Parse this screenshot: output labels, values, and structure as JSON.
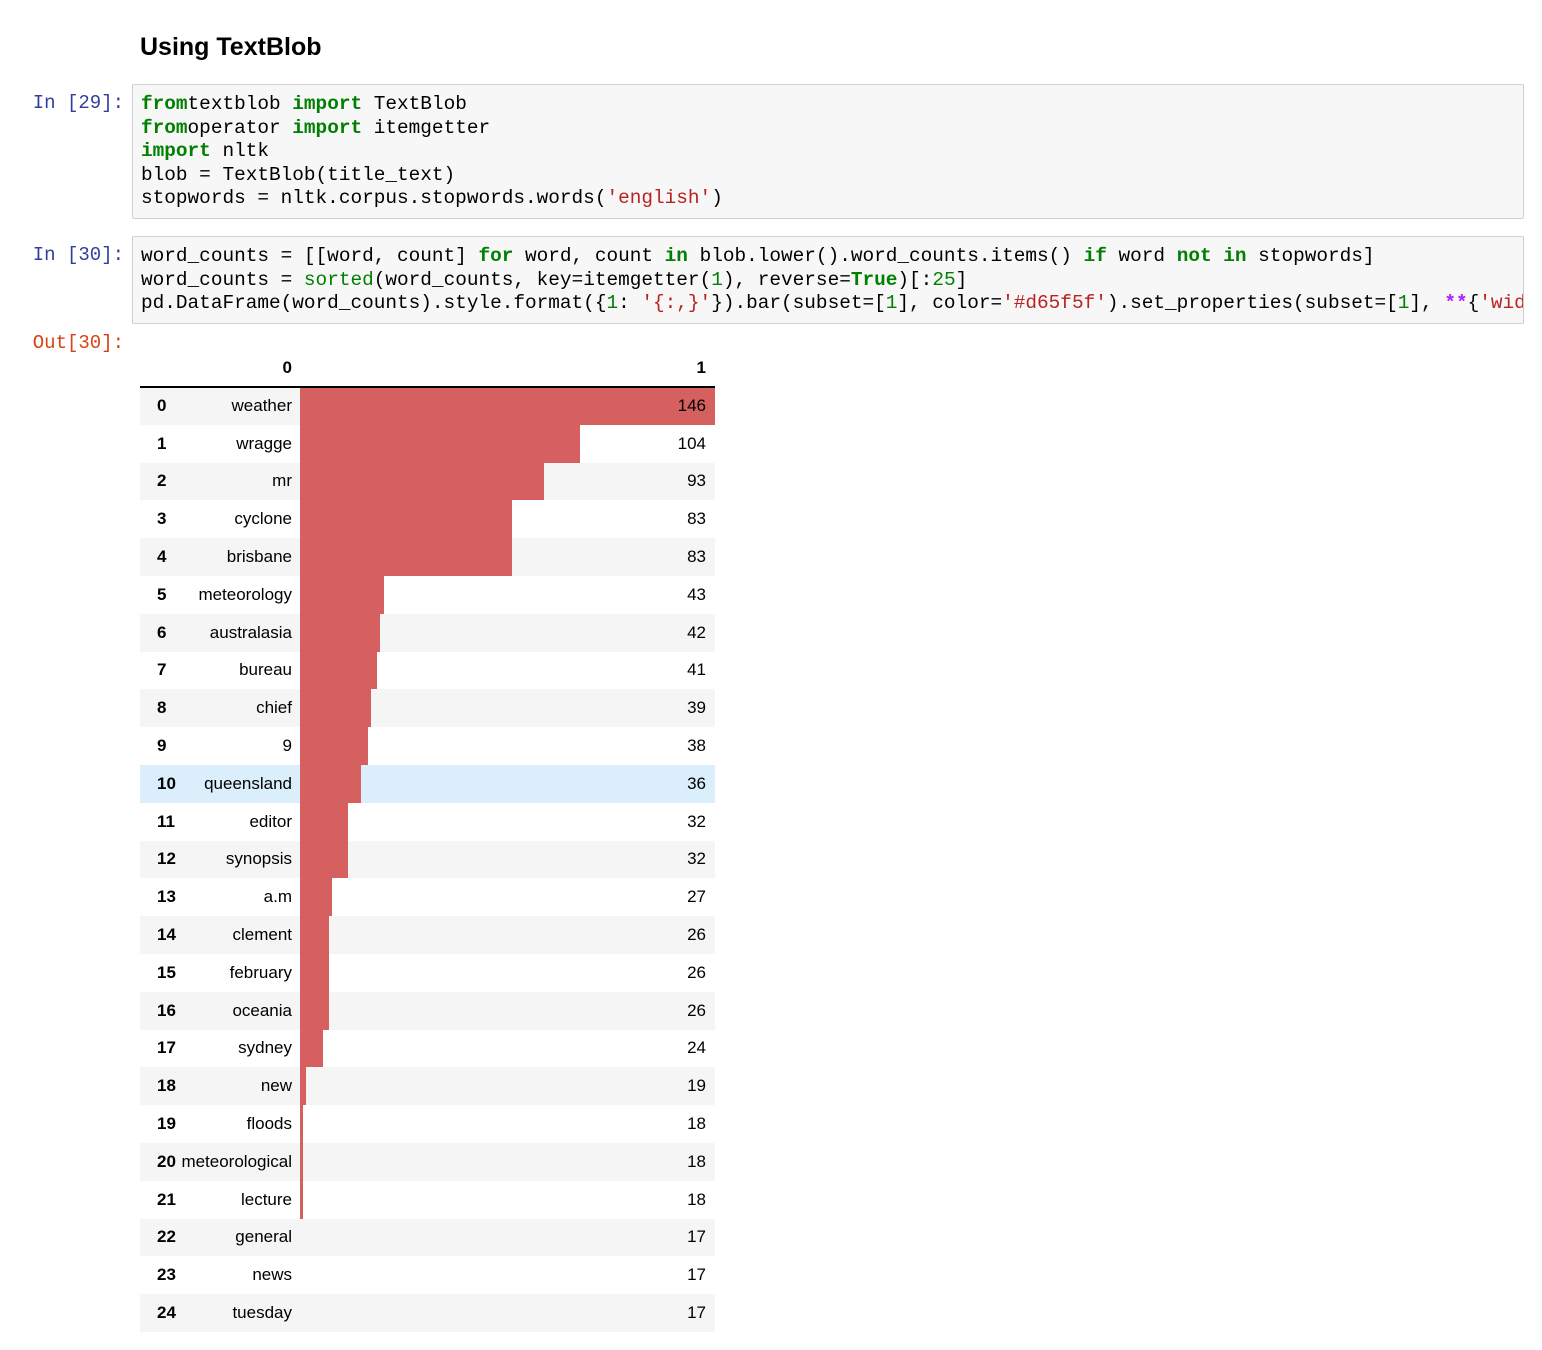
{
  "heading": "Using TextBlob",
  "cells": [
    {
      "prompt": "In [29]:",
      "lines": [
        [
          [
            "kw",
            "from"
          ],
          [
            "",
            "textblob "
          ],
          [
            "kw",
            "import"
          ],
          [
            "",
            " TextBlob"
          ]
        ],
        [
          [
            "kw",
            "from"
          ],
          [
            "",
            "operator "
          ],
          [
            "kw",
            "import"
          ],
          [
            "",
            " itemgetter"
          ]
        ],
        [
          [
            "kw",
            "import"
          ],
          [
            "",
            " nltk"
          ]
        ],
        [
          [
            "",
            "blob = TextBlob(title_text)"
          ]
        ],
        [
          [
            "",
            "stopwords = nltk.corpus.stopwords.words("
          ],
          [
            "str",
            "'english'"
          ],
          [
            "",
            ")"
          ]
        ]
      ]
    },
    {
      "prompt": "In [30]:",
      "lines": [
        [
          [
            "",
            "word_counts = [[word, count] "
          ],
          [
            "kw",
            "for"
          ],
          [
            "",
            " word, count "
          ],
          [
            "kw",
            "in"
          ],
          [
            "",
            " blob.lower().word_counts.items() "
          ],
          [
            "kw",
            "if"
          ],
          [
            "",
            " word "
          ],
          [
            "kw",
            "not"
          ],
          [
            "",
            " "
          ],
          [
            "kw",
            "in"
          ],
          [
            "",
            " stopwords]"
          ]
        ],
        [
          [
            "",
            "word_counts = "
          ],
          [
            "builtin",
            "sorted"
          ],
          [
            "",
            "(word_counts, key=itemgetter("
          ],
          [
            "num",
            "1"
          ],
          [
            "",
            "), reverse="
          ],
          [
            "kw",
            "True"
          ],
          [
            "",
            ")[:"
          ],
          [
            "num",
            "25"
          ],
          [
            "",
            "]"
          ]
        ],
        [
          [
            "",
            "pd.DataFrame(word_counts).style.format({"
          ],
          [
            "num",
            "1"
          ],
          [
            "",
            ": "
          ],
          [
            "str",
            "'{:,}'"
          ],
          [
            "",
            "}).bar(subset=["
          ],
          [
            "num",
            "1"
          ],
          [
            "",
            "], color="
          ],
          [
            "str",
            "'#d65f5f'"
          ],
          [
            "",
            ").set_properties(subset=["
          ],
          [
            "num",
            "1"
          ],
          [
            "",
            "], "
          ],
          [
            "op",
            "**"
          ],
          [
            "",
            "{"
          ],
          [
            "str",
            "'wid"
          ]
        ]
      ]
    }
  ],
  "output": {
    "prompt": "Out[30]:",
    "columns": [
      "0",
      "1"
    ],
    "hovered_row": 10,
    "bar_color": "#d65f5f",
    "rows": [
      {
        "index": "0",
        "word": "weather",
        "count": 146
      },
      {
        "index": "1",
        "word": "wragge",
        "count": 104
      },
      {
        "index": "2",
        "word": "mr",
        "count": 93
      },
      {
        "index": "3",
        "word": "cyclone",
        "count": 83
      },
      {
        "index": "4",
        "word": "brisbane",
        "count": 83
      },
      {
        "index": "5",
        "word": "meteorology",
        "count": 43
      },
      {
        "index": "6",
        "word": "australasia",
        "count": 42
      },
      {
        "index": "7",
        "word": "bureau",
        "count": 41
      },
      {
        "index": "8",
        "word": "chief",
        "count": 39
      },
      {
        "index": "9",
        "word": "9",
        "count": 38
      },
      {
        "index": "10",
        "word": "queensland",
        "count": 36
      },
      {
        "index": "11",
        "word": "editor",
        "count": 32
      },
      {
        "index": "12",
        "word": "synopsis",
        "count": 32
      },
      {
        "index": "13",
        "word": "a.m",
        "count": 27
      },
      {
        "index": "14",
        "word": "clement",
        "count": 26
      },
      {
        "index": "15",
        "word": "february",
        "count": 26
      },
      {
        "index": "16",
        "word": "oceania",
        "count": 26
      },
      {
        "index": "17",
        "word": "sydney",
        "count": 24
      },
      {
        "index": "18",
        "word": "new",
        "count": 19
      },
      {
        "index": "19",
        "word": "floods",
        "count": 18
      },
      {
        "index": "20",
        "word": "meteorological",
        "count": 18
      },
      {
        "index": "21",
        "word": "lecture",
        "count": 18
      },
      {
        "index": "22",
        "word": "general",
        "count": 17
      },
      {
        "index": "23",
        "word": "news",
        "count": 17
      },
      {
        "index": "24",
        "word": "tuesday",
        "count": 17
      }
    ]
  }
}
